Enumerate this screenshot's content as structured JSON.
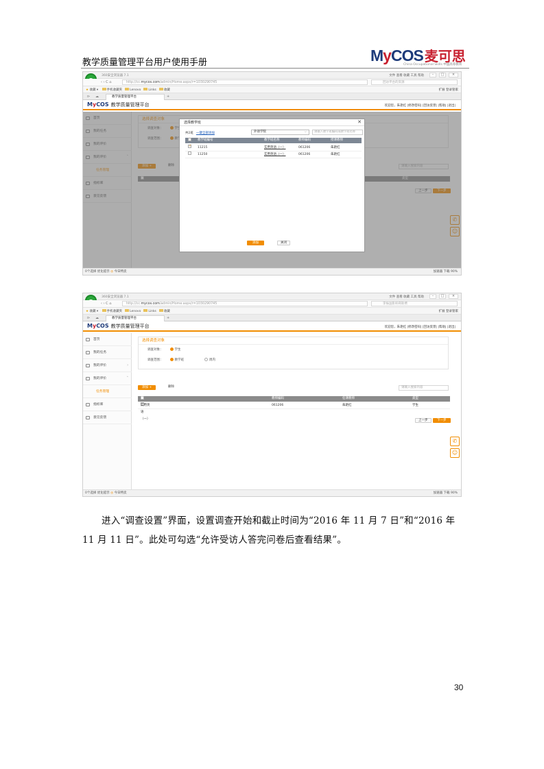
{
  "doc": {
    "header_title": "教学质量管理平台用户使用手册",
    "logo": {
      "text_pre": "M",
      "text_y": "y",
      "text_post": "COS",
      "chinese": "麦可思",
      "tagline": "China Occupational Skills  中国高等教育"
    },
    "paragraph": "进入“调查设置”界面，设置调查开始和截止时间为“2016 年 11 月 7 日”和“2016 年 11 月 11 日”。此处可勾选“允许受访人答完问卷后查看结果”。",
    "page_number": "30"
  },
  "browser": {
    "title": "360安全浏览器 7.1",
    "menu": "文件  查看  收藏  工具  帮助",
    "url_prefix": "http://cc.",
    "url_domain": "mycos.com",
    "url_path": "/admin/Home.aspx/r=1030290745",
    "search_placeholder_1": "回访平台的资源",
    "search_placeholder_2": "李振国影响哥斯费",
    "bookmarks_label": "收藏",
    "bookmarks": [
      "手机收藏夹",
      "Lenovo",
      "Links",
      "收藏"
    ],
    "bookmarks_right": "扩展   登录管家",
    "tab_label": "教学质量管理平台",
    "status_left": "0个选择   优化提示",
    "status_mid": "今日特卖",
    "status_right": "加速器   下载   90%"
  },
  "app": {
    "brand_pre": "M",
    "brand_y": "y",
    "brand_post": "COS",
    "title": "教学质量管理平台",
    "user_links": "欢迎您，朱艳红 |修改密码| |回访反馈| |帮助| |退出|",
    "sidebar": [
      {
        "label": "首页"
      },
      {
        "label": "我的任务"
      },
      {
        "label": "我的评价"
      },
      {
        "label": "我的评价"
      },
      {
        "label": "任务管理"
      },
      {
        "label": "指标库"
      },
      {
        "label": "意见反馈"
      }
    ],
    "section_title": "选择调查对象",
    "label_object": "调查对象：",
    "option_student": "学生",
    "label_scope": "调查范围：",
    "option_class": "教学班",
    "option_period": "周内",
    "btn_add": "添加",
    "btn_delete": "删除",
    "search_placeholder": "请输入搜索内容",
    "btn_prev": "上一步",
    "btn_next": "下一步"
  },
  "table2": {
    "headers": [
      "教学班",
      "教师编码",
      "任课教师",
      "类型"
    ],
    "rows": [
      [
        "实用英语（一）",
        "061206",
        "朱艳红",
        "学生"
      ]
    ]
  },
  "modal": {
    "title": "选择教学班",
    "count": "共2班",
    "select_all": "一键全部添加",
    "dept": "外语学院",
    "search_placeholder": "请输入教学班编码或教学班名称",
    "headers": [
      "教学班编号",
      "教学班名称",
      "教师编码",
      "授课教师"
    ],
    "rows": [
      [
        "11215",
        "实用英语（一）",
        "061206",
        "朱艳红"
      ],
      [
        "11250",
        "实用英语（一）",
        "061206",
        "朱艳红"
      ]
    ],
    "btn_add": "添加",
    "btn_close": "关闭"
  },
  "colors": {
    "accent": "#f18d00",
    "brand_blue": "#1e3b7a",
    "brand_red": "#c8202f"
  },
  "icons": [
    "360-browser-icon",
    "phone-icon",
    "qq-icon",
    "close-icon"
  ]
}
